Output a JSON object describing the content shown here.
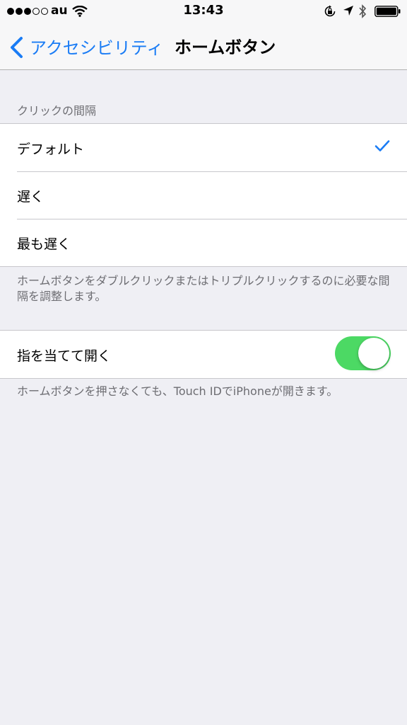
{
  "status_bar": {
    "carrier": "au",
    "time": "13:43",
    "signal_bars_filled": 3,
    "signal_bars_total": 5,
    "icons": [
      "wifi-icon",
      "rotation-lock-icon",
      "location-arrow-icon",
      "bluetooth-icon",
      "battery-icon"
    ]
  },
  "nav": {
    "back_label": "アクセシビリティ",
    "title": "ホームボタン"
  },
  "click_speed": {
    "header": "クリックの間隔",
    "options": [
      {
        "label": "デフォルト",
        "selected": true
      },
      {
        "label": "遅く",
        "selected": false
      },
      {
        "label": "最も遅く",
        "selected": false
      }
    ],
    "footer": "ホームボタンをダブルクリックまたはトリプルクリックするのに必要な間隔を調整します。"
  },
  "rest_finger": {
    "label": "指を当てて開く",
    "enabled": true,
    "footer": "ホームボタンを押さなくても、Touch IDでiPhoneが開きます。"
  },
  "colors": {
    "accent": "#1a7cf5",
    "toggle_on": "#4cd964",
    "background": "#efeff4"
  }
}
